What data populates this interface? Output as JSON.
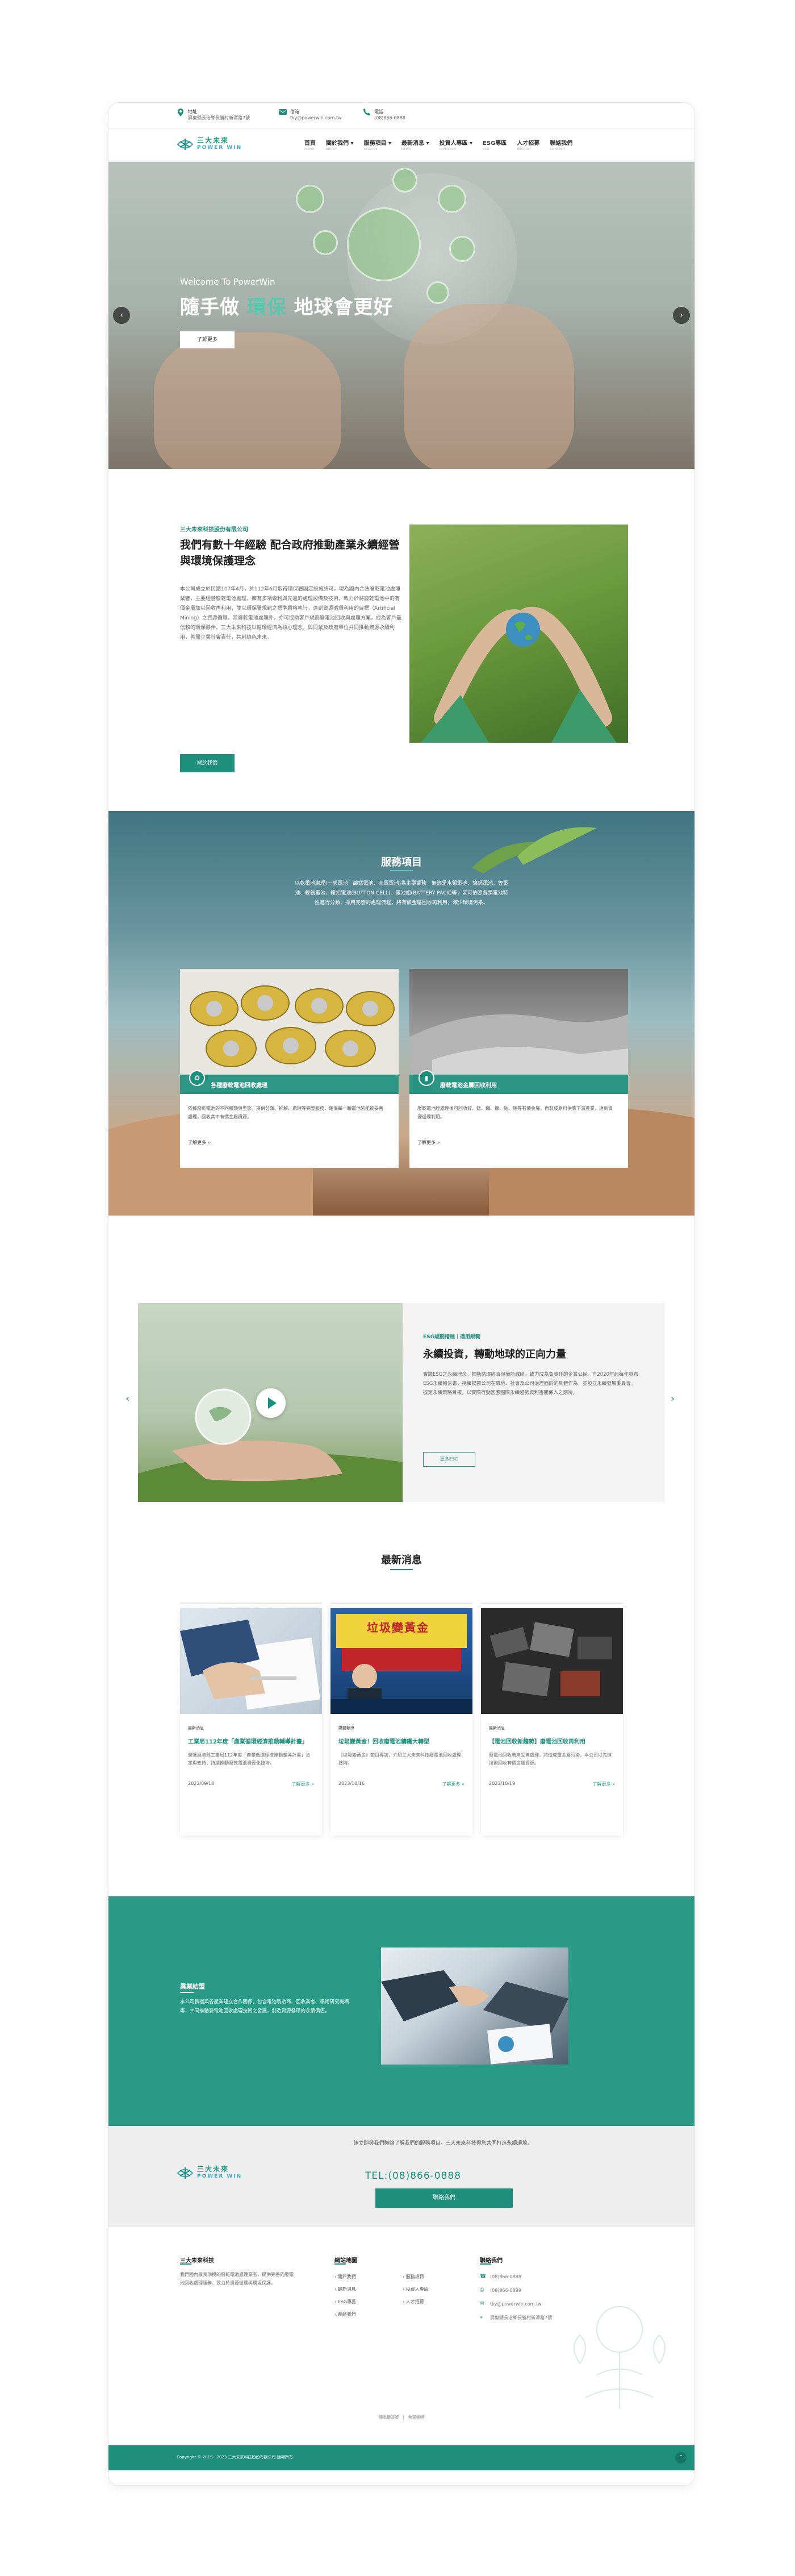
{
  "topbar": {
    "address": {
      "icon": "location-pin-icon",
      "label": "地址",
      "value": "屏東縣長治鄉長勝村新潭路7號"
    },
    "email": {
      "icon": "mail-icon",
      "label": "信箱",
      "value": "tky@powerwin.com.tw"
    },
    "phone": {
      "icon": "phone-icon",
      "label": "電話",
      "value": "(08)866-0888"
    }
  },
  "logo": {
    "zh": "三大未來",
    "en": "POWER WIN"
  },
  "nav": [
    {
      "zh": "首頁",
      "en": "INDEX"
    },
    {
      "zh": "關於我們 ▾",
      "en": "ABOUT"
    },
    {
      "zh": "服務項目 ▾",
      "en": "SERVICE"
    },
    {
      "zh": "最新消息 ▾",
      "en": "NEWS"
    },
    {
      "zh": "投資人專區 ▾",
      "en": "INVESTOR"
    },
    {
      "zh": "ESG專區",
      "en": "ESG"
    },
    {
      "zh": "人才招募",
      "en": "RECRUIT"
    },
    {
      "zh": "聯絡我們",
      "en": "CONTACT"
    }
  ],
  "hero": {
    "subtitle": "Welcome To PowerWin",
    "title_a": "隨手做",
    "title_hl": "環保",
    "title_b": "地球會更好",
    "button": "了解更多",
    "prev": "‹",
    "next": "›"
  },
  "about": {
    "company": "三大未來科技股份有限公司",
    "title": "我們有數十年經驗 配合政府推動產業永續經營與環境保護理念",
    "body": "本公司成立於民國107年4月，於112年6月取得環保署固定設施許可，現為國內合法廢乾電池處理業者，主要經營廢乾電池處理，擁有多項專利與先進的處理設備及技術。致力於將廢乾電池中的有價金屬加以回收再利用，並以環保署規範之標準嚴格執行，達到資源循環利用的目標（Artificial Mining）之資源循環。除廢乾電池處理外，亦可協助客戶規劃廢電池回收與處理方案，成為客戶最信賴的環保夥伴。三大未來科技以循環經濟為核心理念，與同業及政府單位共同推動資源永續利用，善盡企業社會責任，共創綠色未來。",
    "button": "關於我們"
  },
  "services": {
    "title": "服務項目",
    "desc": "以乾電池處理(一般電池、鹼錳電池、充電電池)為主要業務，無論是水銀電池、鎳鎘電池、鋰電池、鎳氫電池、鈕扣電池(BUTTON CELL)、電池組(BATTERY PACK)等，皆可依照各類電池特性進行分類，採用完善的處理流程，將有價金屬回收再利用，減少環境污染。",
    "cards": [
      {
        "icon": "recycle-leaf-icon",
        "name": "各種廢乾電池回收處理",
        "text": "依據廢乾電池的不同種類與型態，提供分類、拆解、處理等完整服務，確保每一顆電池皆能被妥善處理，回收其中有價金屬資源。",
        "more": "了解更多 »"
      },
      {
        "icon": "battery-icon",
        "name": "廢乾電池金屬回收利用",
        "text": "廢乾電池經處理後可回收鋅、錳、鐵、鎳、鈷、鋰等有價金屬，再製成原料供應下游產業，達到資源循環利用。",
        "more": "了解更多 »"
      }
    ]
  },
  "esg": {
    "sub": "ESG規劃措施｜適用規範",
    "title": "永續投資，轉動地球的正向力量",
    "body": "實踐ESG之永續理念，推動循環經濟與節能減碳，致力成為負責任的企業公民。自2020年起每年發布ESG永續報告書，持續揭露公司在環境、社會及公司治理面向的具體作為，並設立永續發展委員會，擬定永續策略目標，以實際行動回應國際永續趨勢與利害關係人之期待。",
    "button": "更多ESG",
    "prev": "‹",
    "next": "›"
  },
  "news": {
    "title": "最新消息",
    "items": [
      {
        "cat": "最新消息",
        "head": "工業局112年度「產業循環經濟推動輔導計畫」",
        "sum": "榮獲經濟部工業局112年度「產業循環經濟推動輔導計畫」肯定與支持，持續推動廢乾電池資源化技術。",
        "date": "2023/09/18",
        "more": "了解更多 »",
        "photo": "document-photo"
      },
      {
        "cat": "媒體報導",
        "head": "垃圾變黃金！回收廢電池鑄鐵大轉型",
        "sum": "《垃圾變黃金》節目專訪，介紹三大未來科技廢電池回收處理技術。",
        "date": "2023/10/16",
        "more": "了解更多 »",
        "photo": "tv-news-photo"
      },
      {
        "cat": "最新消息",
        "head": "【電池回收新趨勢】廢電池回收再利用",
        "sum": "廢電池回收若未妥善處理，將造成重金屬污染，本公司以先進技術回收有價金屬資源。",
        "date": "2023/10/19",
        "more": "了解更多 »",
        "photo": "battery-pile-photo"
      }
    ],
    "tv_caption": "垃圾變黃金"
  },
  "cooperation": {
    "title": "異業結盟",
    "text": "本公司積極與各產業建立合作關係，包含電池製造商、回收業者、學術研究機構等，共同推動廢電池回收處理技術之發展，創造資源循環的永續價值。"
  },
  "cta": {
    "text": "請立即與我們聯絡了解我們的服務項目，三大未來科技與您共同打造永續環境。",
    "tel": "TEL:(08)866-0888",
    "button": "聯絡我們"
  },
  "footer": {
    "about_title": "三大未來科技",
    "about_text": "我們國內最具規模的廢乾電池處理業者，提供完善的廢電池回收處理服務，致力於資源循環與環境保護。",
    "sitemap_title": "網站地圖",
    "sitemap": [
      "關於我們",
      "最新消息",
      "ESG專區",
      "聯絡我們",
      "服務項目",
      "投資人專區",
      "人才招募"
    ],
    "contact_title": "聯絡我們",
    "contacts": [
      {
        "icon": "phone-icon",
        "text": "(08)866-0888"
      },
      {
        "icon": "fax-icon",
        "text": "(08)866-0899"
      },
      {
        "icon": "mail-icon",
        "text": "tky@powerwin.com.tw"
      },
      {
        "icon": "location-pin-icon",
        "text": "屏東縣長治鄉長勝村新潭路7號"
      }
    ],
    "bottom_links": "隱私權政策　|　免責聲明",
    "copyright": "Copyright © 2015 - 2023 三大未來科技股份有限公司 版權所有",
    "to_top": "⌃"
  }
}
